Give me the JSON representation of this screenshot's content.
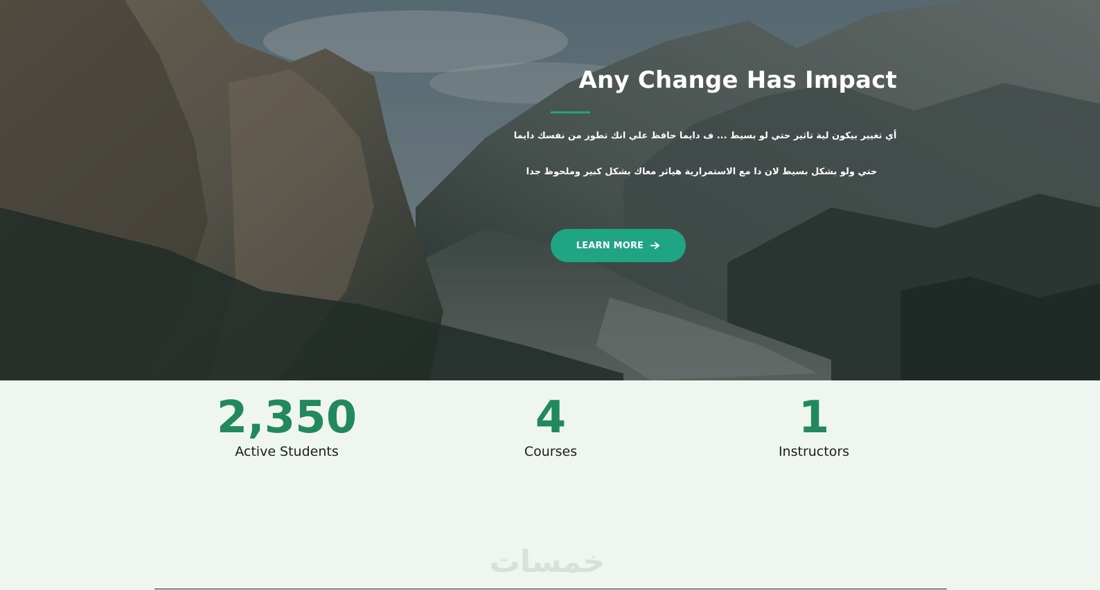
{
  "hero": {
    "title": "Any Change Has Impact",
    "line1": "أي تغيير بيكون لية تاثير حتي لو بسيط ... ف دايما حافظ علي انك تطور من نفسك دايما",
    "line2": "حتي ولو بشكل بسيط لان دا مع الاستمرارية هياثر معاك بشكل كبير وملحوظ جدا",
    "button_label": "LEARN MORE",
    "button_icon": "arrow-right-icon",
    "accent_color": "#1fa584"
  },
  "stats": [
    {
      "value": "2,350",
      "label": "Active Students"
    },
    {
      "value": "4",
      "label": "Courses"
    },
    {
      "value": "1",
      "label": "Instructors"
    }
  ],
  "stats_color": "#23885e",
  "watermark": "خمسات"
}
